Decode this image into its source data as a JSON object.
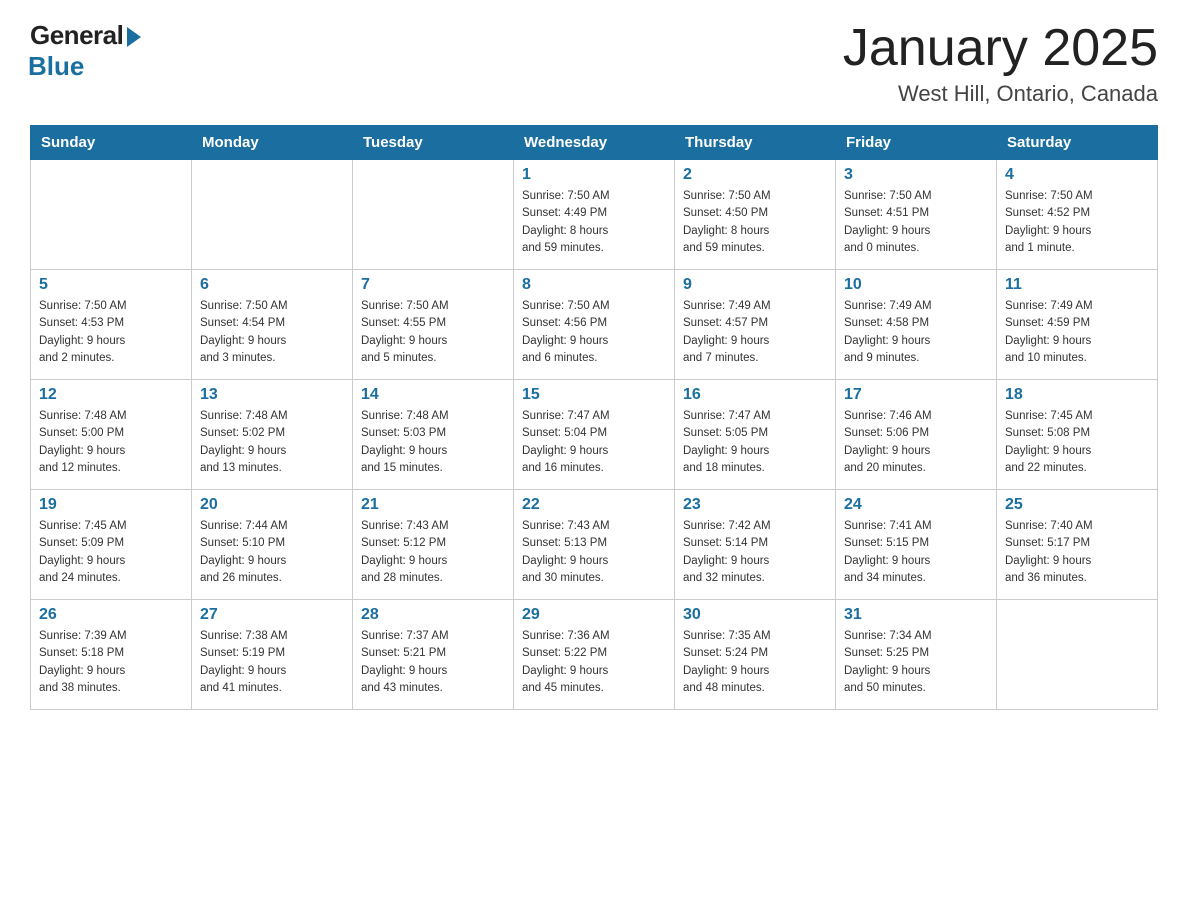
{
  "logo": {
    "general": "General",
    "blue": "Blue"
  },
  "title": {
    "month_year": "January 2025",
    "location": "West Hill, Ontario, Canada"
  },
  "weekdays": [
    "Sunday",
    "Monday",
    "Tuesday",
    "Wednesday",
    "Thursday",
    "Friday",
    "Saturday"
  ],
  "weeks": [
    [
      {
        "day": "",
        "info": ""
      },
      {
        "day": "",
        "info": ""
      },
      {
        "day": "",
        "info": ""
      },
      {
        "day": "1",
        "info": "Sunrise: 7:50 AM\nSunset: 4:49 PM\nDaylight: 8 hours\nand 59 minutes."
      },
      {
        "day": "2",
        "info": "Sunrise: 7:50 AM\nSunset: 4:50 PM\nDaylight: 8 hours\nand 59 minutes."
      },
      {
        "day": "3",
        "info": "Sunrise: 7:50 AM\nSunset: 4:51 PM\nDaylight: 9 hours\nand 0 minutes."
      },
      {
        "day": "4",
        "info": "Sunrise: 7:50 AM\nSunset: 4:52 PM\nDaylight: 9 hours\nand 1 minute."
      }
    ],
    [
      {
        "day": "5",
        "info": "Sunrise: 7:50 AM\nSunset: 4:53 PM\nDaylight: 9 hours\nand 2 minutes."
      },
      {
        "day": "6",
        "info": "Sunrise: 7:50 AM\nSunset: 4:54 PM\nDaylight: 9 hours\nand 3 minutes."
      },
      {
        "day": "7",
        "info": "Sunrise: 7:50 AM\nSunset: 4:55 PM\nDaylight: 9 hours\nand 5 minutes."
      },
      {
        "day": "8",
        "info": "Sunrise: 7:50 AM\nSunset: 4:56 PM\nDaylight: 9 hours\nand 6 minutes."
      },
      {
        "day": "9",
        "info": "Sunrise: 7:49 AM\nSunset: 4:57 PM\nDaylight: 9 hours\nand 7 minutes."
      },
      {
        "day": "10",
        "info": "Sunrise: 7:49 AM\nSunset: 4:58 PM\nDaylight: 9 hours\nand 9 minutes."
      },
      {
        "day": "11",
        "info": "Sunrise: 7:49 AM\nSunset: 4:59 PM\nDaylight: 9 hours\nand 10 minutes."
      }
    ],
    [
      {
        "day": "12",
        "info": "Sunrise: 7:48 AM\nSunset: 5:00 PM\nDaylight: 9 hours\nand 12 minutes."
      },
      {
        "day": "13",
        "info": "Sunrise: 7:48 AM\nSunset: 5:02 PM\nDaylight: 9 hours\nand 13 minutes."
      },
      {
        "day": "14",
        "info": "Sunrise: 7:48 AM\nSunset: 5:03 PM\nDaylight: 9 hours\nand 15 minutes."
      },
      {
        "day": "15",
        "info": "Sunrise: 7:47 AM\nSunset: 5:04 PM\nDaylight: 9 hours\nand 16 minutes."
      },
      {
        "day": "16",
        "info": "Sunrise: 7:47 AM\nSunset: 5:05 PM\nDaylight: 9 hours\nand 18 minutes."
      },
      {
        "day": "17",
        "info": "Sunrise: 7:46 AM\nSunset: 5:06 PM\nDaylight: 9 hours\nand 20 minutes."
      },
      {
        "day": "18",
        "info": "Sunrise: 7:45 AM\nSunset: 5:08 PM\nDaylight: 9 hours\nand 22 minutes."
      }
    ],
    [
      {
        "day": "19",
        "info": "Sunrise: 7:45 AM\nSunset: 5:09 PM\nDaylight: 9 hours\nand 24 minutes."
      },
      {
        "day": "20",
        "info": "Sunrise: 7:44 AM\nSunset: 5:10 PM\nDaylight: 9 hours\nand 26 minutes."
      },
      {
        "day": "21",
        "info": "Sunrise: 7:43 AM\nSunset: 5:12 PM\nDaylight: 9 hours\nand 28 minutes."
      },
      {
        "day": "22",
        "info": "Sunrise: 7:43 AM\nSunset: 5:13 PM\nDaylight: 9 hours\nand 30 minutes."
      },
      {
        "day": "23",
        "info": "Sunrise: 7:42 AM\nSunset: 5:14 PM\nDaylight: 9 hours\nand 32 minutes."
      },
      {
        "day": "24",
        "info": "Sunrise: 7:41 AM\nSunset: 5:15 PM\nDaylight: 9 hours\nand 34 minutes."
      },
      {
        "day": "25",
        "info": "Sunrise: 7:40 AM\nSunset: 5:17 PM\nDaylight: 9 hours\nand 36 minutes."
      }
    ],
    [
      {
        "day": "26",
        "info": "Sunrise: 7:39 AM\nSunset: 5:18 PM\nDaylight: 9 hours\nand 38 minutes."
      },
      {
        "day": "27",
        "info": "Sunrise: 7:38 AM\nSunset: 5:19 PM\nDaylight: 9 hours\nand 41 minutes."
      },
      {
        "day": "28",
        "info": "Sunrise: 7:37 AM\nSunset: 5:21 PM\nDaylight: 9 hours\nand 43 minutes."
      },
      {
        "day": "29",
        "info": "Sunrise: 7:36 AM\nSunset: 5:22 PM\nDaylight: 9 hours\nand 45 minutes."
      },
      {
        "day": "30",
        "info": "Sunrise: 7:35 AM\nSunset: 5:24 PM\nDaylight: 9 hours\nand 48 minutes."
      },
      {
        "day": "31",
        "info": "Sunrise: 7:34 AM\nSunset: 5:25 PM\nDaylight: 9 hours\nand 50 minutes."
      },
      {
        "day": "",
        "info": ""
      }
    ]
  ]
}
